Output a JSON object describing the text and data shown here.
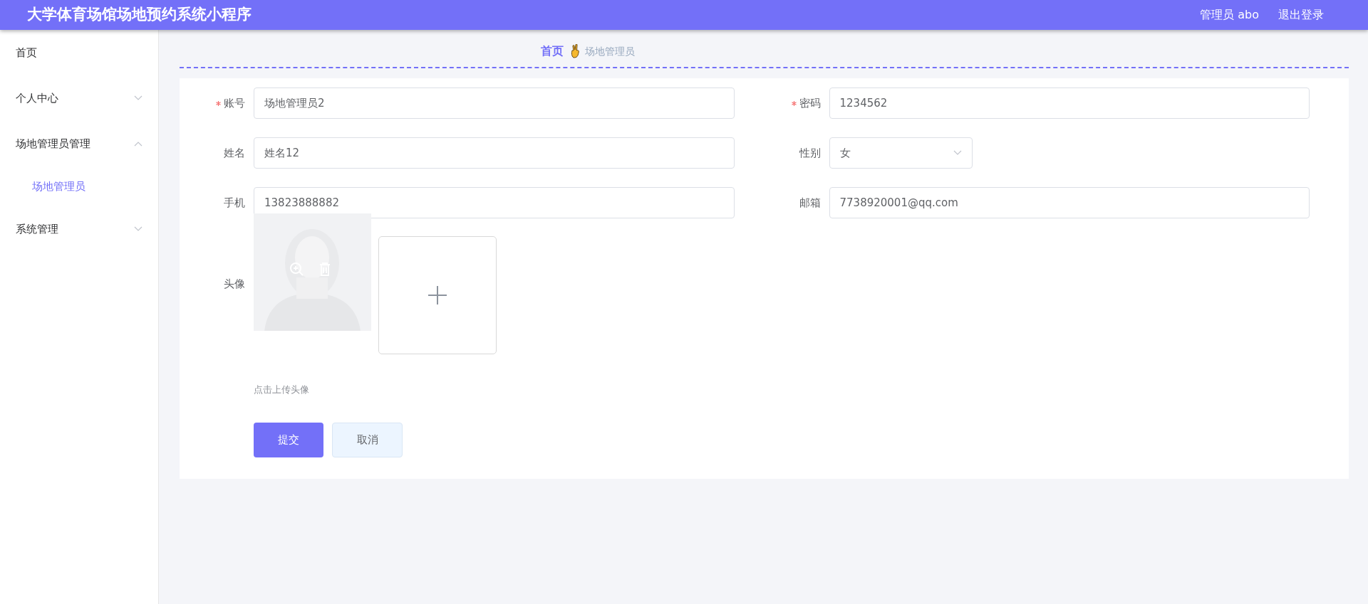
{
  "header": {
    "title": "大学体育场馆场地预约系统小程序",
    "user": "管理员 abo",
    "logout": "退出登录"
  },
  "sidebar": {
    "items": [
      {
        "label": "首页",
        "kind": "link"
      },
      {
        "label": "个人中心",
        "kind": "menu",
        "expanded": false
      },
      {
        "label": "场地管理员管理",
        "kind": "menu",
        "expanded": true,
        "children": [
          {
            "label": "场地管理员",
            "selected": true
          }
        ]
      },
      {
        "label": "系统管理",
        "kind": "menu",
        "expanded": false
      }
    ]
  },
  "breadcrumb": [
    {
      "label": "首页",
      "kind": "link"
    },
    {
      "label": "场地管理员",
      "kind": "current"
    }
  ],
  "form": {
    "fields": [
      {
        "label": "账号",
        "required": true,
        "kind": "text",
        "value": "场地管理员2"
      },
      {
        "label": "密码",
        "required": true,
        "kind": "text",
        "value": "1234562"
      },
      {
        "label": "姓名",
        "required": false,
        "kind": "text",
        "value": "姓名12"
      },
      {
        "label": "性别",
        "required": false,
        "kind": "select",
        "value": "女"
      },
      {
        "label": "手机",
        "required": false,
        "kind": "text",
        "value": "13823888882"
      },
      {
        "label": "邮箱",
        "required": false,
        "kind": "text",
        "value": "7738920001@qq.com"
      }
    ],
    "avatar": {
      "label": "头像",
      "hint": "点击上传头像"
    },
    "buttons": [
      {
        "label": "提交",
        "kind": "primary"
      },
      {
        "label": "取消",
        "kind": "secondary"
      }
    ]
  }
}
